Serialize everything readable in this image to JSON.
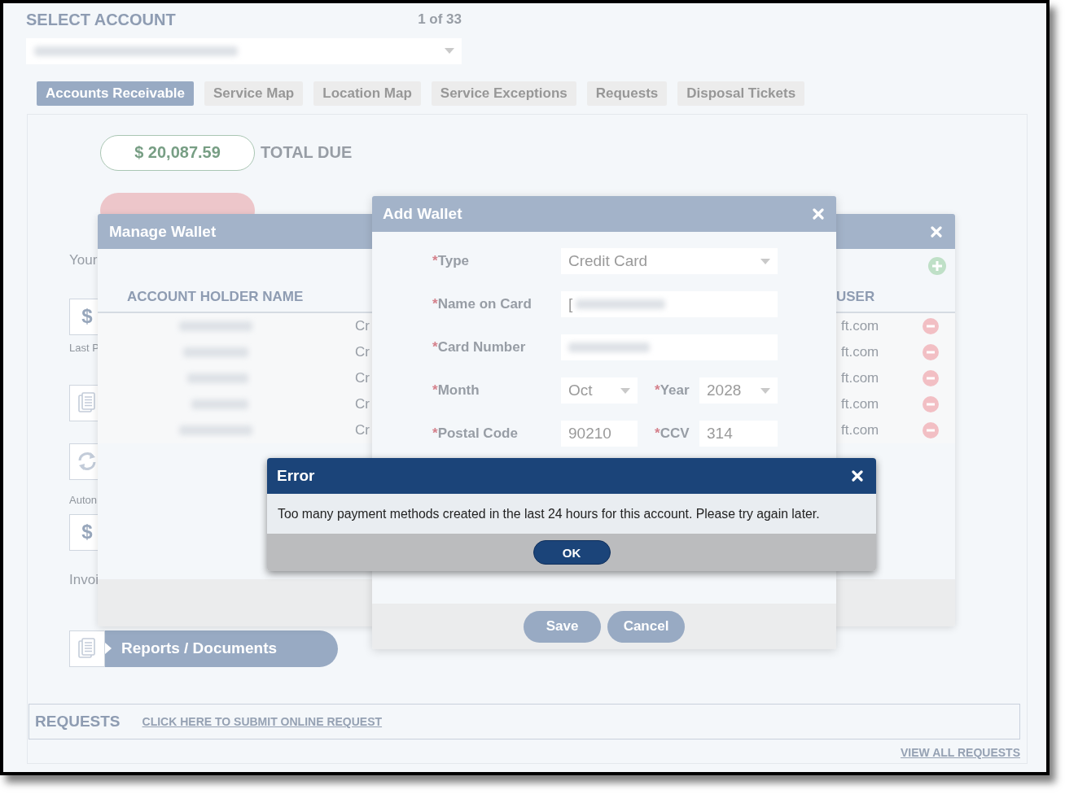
{
  "header": {
    "title": "SELECT ACCOUNT",
    "counter": "1 of 33"
  },
  "tabs": [
    {
      "label": "Accounts Receivable",
      "selected": true
    },
    {
      "label": "Service Map",
      "selected": false
    },
    {
      "label": "Location Map",
      "selected": false
    },
    {
      "label": "Service Exceptions",
      "selected": false
    },
    {
      "label": "Requests",
      "selected": false
    },
    {
      "label": "Disposal Tickets",
      "selected": false
    }
  ],
  "summary": [
    {
      "kind": "total",
      "amount": "$ 20,087.59",
      "label": "TOTAL DUE"
    },
    {
      "kind": "past"
    }
  ],
  "overview": {
    "intro": "Your",
    "payment_icon": "$",
    "payment_caption": "Last P",
    "autopay_caption": "Auton",
    "invoice_icon": "$",
    "invoice_caption": "Invoi",
    "reports_button": "Reports / Documents"
  },
  "requests": {
    "title": "REQUESTS",
    "submit_link": "CLICK HERE TO SUBMIT ONLINE REQUEST",
    "view_all_link": "VIEW ALL REQUESTS"
  },
  "manage_wallet": {
    "title": "Manage Wallet",
    "columns": [
      "ACCOUNT HOLDER NAME",
      "USER"
    ],
    "rows": [
      {
        "type": "Cr",
        "user": "ft.com"
      },
      {
        "type": "Cr",
        "user": "ft.com"
      },
      {
        "type": "Cr",
        "user": "ft.com"
      },
      {
        "type": "Cr",
        "user": "ft.com"
      },
      {
        "type": "Cr",
        "user": "ft.com"
      }
    ]
  },
  "add_wallet": {
    "title": "Add Wallet",
    "rows": [
      {
        "fields": [
          {
            "marker": "*",
            "label": "Type",
            "kind": "select",
            "value": "Credit Card",
            "redacted": false
          }
        ]
      },
      {
        "fields": [
          {
            "marker": "*",
            "label": "Name on Card",
            "kind": "text",
            "value": "[",
            "redacted": true
          }
        ]
      },
      {
        "fields": [
          {
            "marker": "*",
            "label": "Card Number",
            "kind": "text",
            "redacted": true
          }
        ]
      },
      {
        "fields": [
          {
            "marker": "*",
            "label": "Month",
            "kind": "select",
            "value": "Oct",
            "redacted": false
          },
          {
            "marker": "*",
            "label": "Year",
            "kind": "select",
            "value": "2028",
            "redacted": false
          }
        ]
      },
      {
        "fields": [
          {
            "marker": "*",
            "label": "Postal Code",
            "kind": "text",
            "value": "90210",
            "redacted": false
          },
          {
            "marker": "*",
            "label": "CCV",
            "kind": "text",
            "value": "314",
            "redacted": false
          }
        ]
      }
    ],
    "buttons": [
      "Save",
      "Cancel"
    ]
  },
  "error_dialog": {
    "title": "Error",
    "message": "Too many payment methods created in the last 24 hours for this account. Please try again later.",
    "button": "OK"
  }
}
